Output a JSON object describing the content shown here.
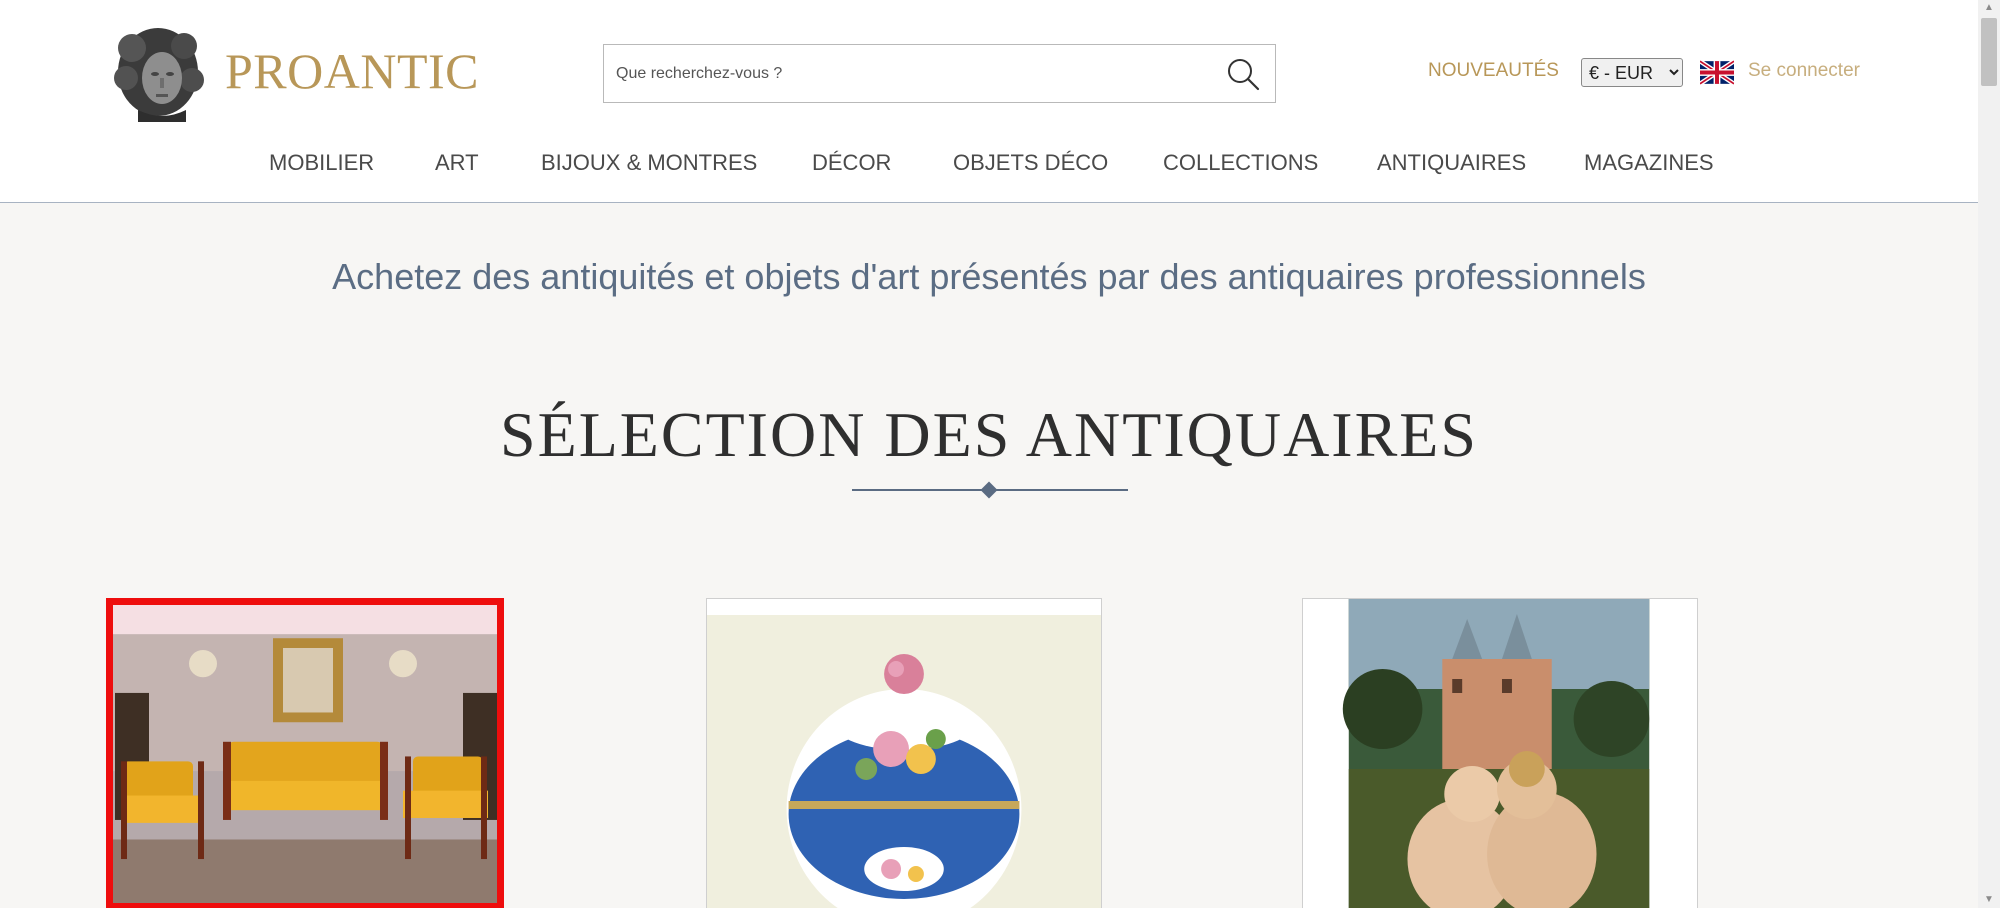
{
  "header": {
    "logo_text": "PROANTIC",
    "search": {
      "placeholder": "Que recherchez-vous ?"
    },
    "nouveautes": "NOUVEAUTÉS",
    "currency": {
      "selected": "€ - EUR"
    },
    "language_icon": "uk-flag-icon",
    "connect": "Se connecter"
  },
  "nav": {
    "items": [
      {
        "label": "MOBILIER"
      },
      {
        "label": "ART"
      },
      {
        "label": "BIJOUX & MONTRES"
      },
      {
        "label": "DÉCOR"
      },
      {
        "label": "OBJETS DÉCO"
      },
      {
        "label": "COLLECTIONS"
      },
      {
        "label": "ANTIQUAIRES"
      },
      {
        "label": "MAGAZINES"
      }
    ]
  },
  "main": {
    "tagline": "Achetez des antiquités et objets d'art présentés par des antiquaires professionnels",
    "section_title": "SÉLECTION DES ANTIQUAIRES",
    "cards": [
      {
        "image": "empire-salon-furniture"
      },
      {
        "image": "porcelain-covered-pot"
      },
      {
        "image": "flemish-painting-children-kissing"
      }
    ]
  },
  "colors": {
    "brand_gold": "#b89758",
    "nav_text": "#4a4a4a",
    "tagline": "#5b6d84",
    "highlight_border": "#ee0d0d",
    "background": "#f7f6f4"
  }
}
